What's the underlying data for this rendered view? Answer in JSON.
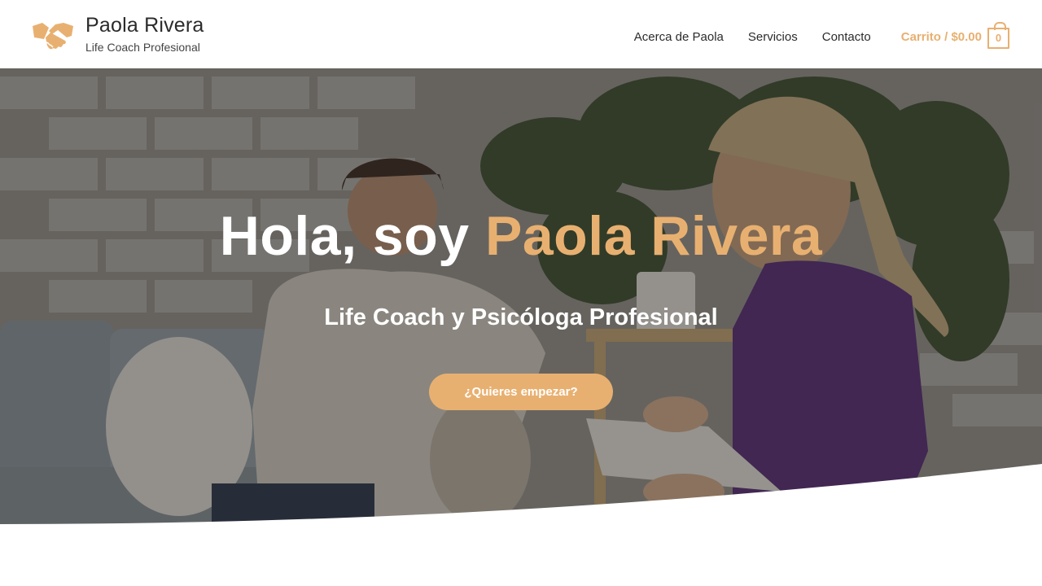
{
  "header": {
    "logo_icon": "handshake-icon",
    "site_title": "Paola Rivera",
    "tagline": "Life Coach Profesional",
    "nav": {
      "about": "Acerca de Paola",
      "services": "Servicios",
      "contact": "Contacto"
    },
    "cart": {
      "label": "Carrito / $0.00",
      "count": "0",
      "icon": "shopping-bag-icon"
    }
  },
  "hero": {
    "title_prefix": "Hola, soy ",
    "title_name": "Paola Rivera",
    "subtitle": "Life Coach y Psicóloga Profesional",
    "cta_label": "¿Quieres empezar?"
  },
  "colors": {
    "accent": "#e8b070",
    "text_dark": "#2b2b2b",
    "white": "#ffffff"
  }
}
